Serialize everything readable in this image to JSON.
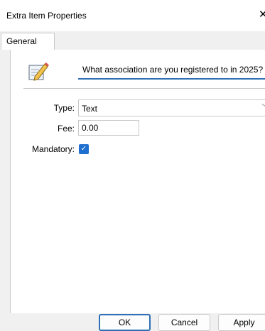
{
  "window": {
    "title": "Extra Item Properties",
    "close_glyph": "✕"
  },
  "tabs": [
    {
      "label": "General",
      "active": true
    }
  ],
  "general": {
    "name_value": "What association are you registered to in 2025?",
    "type_label": "Type:",
    "type_value": "Text",
    "fee_label": "Fee:",
    "fee_value": "0.00",
    "mandatory_label": "Mandatory:",
    "mandatory_checked": true,
    "icon": "pencil-note-icon"
  },
  "buttons": {
    "ok": "OK",
    "cancel": "Cancel",
    "apply": "Apply"
  },
  "colors": {
    "accent": "#2f6fb5",
    "checkbox": "#1f6fd1"
  }
}
